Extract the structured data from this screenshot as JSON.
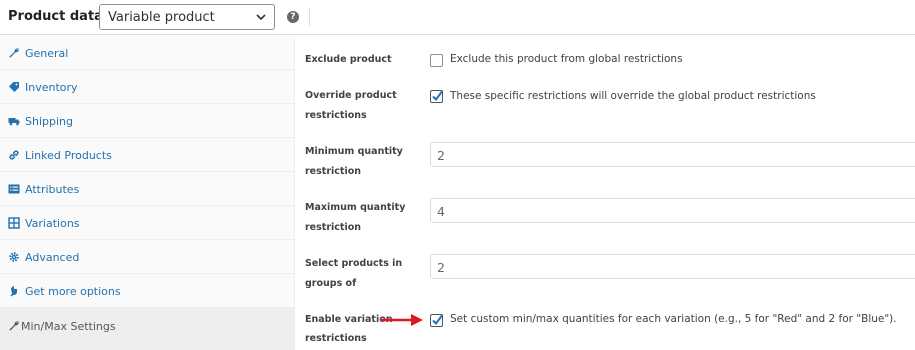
{
  "header": {
    "title": "Product data —",
    "product_type": "Variable product",
    "help_icon_glyph": "?"
  },
  "sidebar": {
    "items": [
      {
        "label": "General",
        "icon": "wrench-icon"
      },
      {
        "label": "Inventory",
        "icon": "tag-icon"
      },
      {
        "label": "Shipping",
        "icon": "truck-icon"
      },
      {
        "label": "Linked Products",
        "icon": "link-icon"
      },
      {
        "label": "Attributes",
        "icon": "list-icon"
      },
      {
        "label": "Variations",
        "icon": "grid-icon"
      },
      {
        "label": "Advanced",
        "icon": "gear-icon"
      },
      {
        "label": "Get more options",
        "icon": "plugin-icon"
      },
      {
        "label": "Min/Max Settings",
        "icon": "wrench-icon",
        "active": true
      }
    ]
  },
  "form": {
    "exclude": {
      "label": "Exclude product",
      "checkbox_text": "Exclude this product from global restrictions",
      "checked": false
    },
    "override": {
      "label_line1": "Override product",
      "label_line2": "restrictions",
      "checkbox_text": "These specific restrictions will override the global product restrictions",
      "checked": true
    },
    "min_qty": {
      "label_line1": "Minimum quantity",
      "label_line2": "restriction",
      "value": "2"
    },
    "max_qty": {
      "label_line1": "Maximum quantity",
      "label_line2": "restriction",
      "value": "4"
    },
    "groups": {
      "label_line1": "Select products in",
      "label_line2": "groups of",
      "value": "2"
    },
    "variation": {
      "label_line1": "Enable variation",
      "label_line2": "restrictions",
      "checkbox_text": "Set custom min/max quantities for each variation (e.g., 5 for \"Red\" and 2 for \"Blue\").",
      "checked": true
    }
  },
  "colors": {
    "link": "#2271b1",
    "arrow": "#e0191d",
    "active_tab_bg": "#eeeeee"
  }
}
